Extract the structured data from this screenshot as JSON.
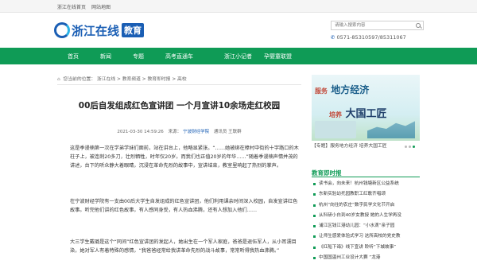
{
  "topbar": {
    "home": "浙江在线首页",
    "sitemap": "网站地图"
  },
  "logo": {
    "main": "浙江在线",
    "badge": "教育"
  },
  "search": {
    "placeholder": "请输入搜索内容"
  },
  "hotline": {
    "text": "0571-85310597/85311067"
  },
  "nav": [
    "首页",
    "新闻",
    "专题",
    "高考直通车",
    "浙江小记者",
    "孕婴童联盟"
  ],
  "breadcrumb": {
    "prefix": "您当前的位置：",
    "items": [
      "浙江在线",
      "教育频道",
      "教育即时报",
      "高校"
    ],
    "separator": ">"
  },
  "article": {
    "title": "00后自发组成红色宣讲团 一个月宣讲10余场走红校园",
    "date": "2021-03-30 14:59:26",
    "source_label": "来源：",
    "source": "宁波财经学院",
    "reporter": "通讯员 王联群",
    "paragraphs": [
      "这是季漫楠第一次在学弟学妹们面前，站在讲台上，他略显紧张。“……她被绑在樟村中街的十字路口的木柱子上，被连刺20多刀，壮烈牺牲，时年仅20岁。而我们也正值20岁的年华……”随着季漫楠声情并茂的讲述，台下的听众静大着眼睛，沉浸在革命先烈的故事中，宣讲结束，教室里响起了热烈的掌声。",
      "在宁波财经学院有一支由00后大学生自发组成的红色宣讲团，他们利用课余时间深入校园，自发宣讲红色故事。听完他们讲的红色故事，有人感同身受，有人热血沸腾，还有人想加入他们……",
      "大三学生戴璐是这个“同间”红色宣讲团的发起人，她出生在一个军人家庭，爸爸是退伍军人，从小耳濡目染，她对军人有着特殊的感情，“我爸爸经常给我讲革命先烈的战斗故事，常常听得我热血沸腾。”"
    ]
  },
  "banner": {
    "line1_char": "服务",
    "line1": "地方经济",
    "line2_char": "培养",
    "line2": "大国工匠",
    "caption": "【专题】服务地方经济 培养大国工匠"
  },
  "sidebar": {
    "heading": "教育即时报",
    "items": [
      "读书会，向未来！杭州钱塘新区公益系统",
      "东新实验幼托园教职工红歌齐唱颂",
      "杭州“向往的农庄”数字民学文化节开启",
      "从科研小白到40岁女教授 她的人生学再没",
      "浦江区钱江港幼儿园：“小水滴”亲子园",
      "让师生感爱体验式学习 这所高校的党史教",
      "《红船下诲》线下宣讲 聆听“下城故事”",
      "中国国温州工业设计大赛 “龙港"
    ]
  }
}
